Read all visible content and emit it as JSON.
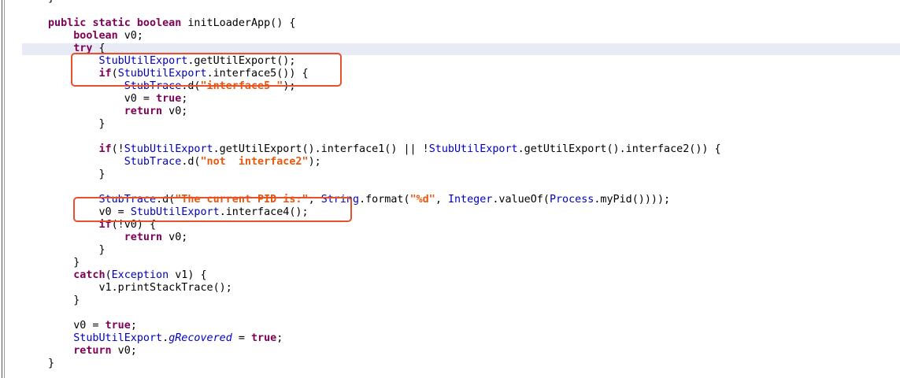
{
  "code_lines": [
    "}",
    "",
    "public static boolean initLoaderApp() {",
    "    boolean v0;",
    "    try {",
    "        StubUtilExport.getUtilExport();",
    "        if(StubUtilExport.interface5()) {",
    "            StubTrace.d(\"interface5 \");",
    "            v0 = true;",
    "            return v0;",
    "        }",
    "",
    "        if(!StubUtilExport.getUtilExport().interface1() || !StubUtilExport.getUtilExport().interface2()) {",
    "            StubTrace.d(\"not  interface2\");",
    "        }",
    "",
    "        StubTrace.d(\"The current PID is:\", String.format(\"%d\", Integer.valueOf(Process.myPid())));",
    "        v0 = StubUtilExport.interface4();",
    "        if(!v0) {",
    "            return v0;",
    "        }",
    "    }",
    "    catch(Exception v1) {",
    "        v1.printStackTrace();",
    "    }",
    "",
    "    v0 = true;",
    "    StubUtilExport.gRecovered = true;",
    "    return v0;",
    "}"
  ],
  "colors": {
    "keyword": "#7f0055",
    "class_ref": "#0000c0",
    "string": "#e8580c",
    "annotation_box": "#e4512c",
    "current_line": "#e8eaf6"
  }
}
